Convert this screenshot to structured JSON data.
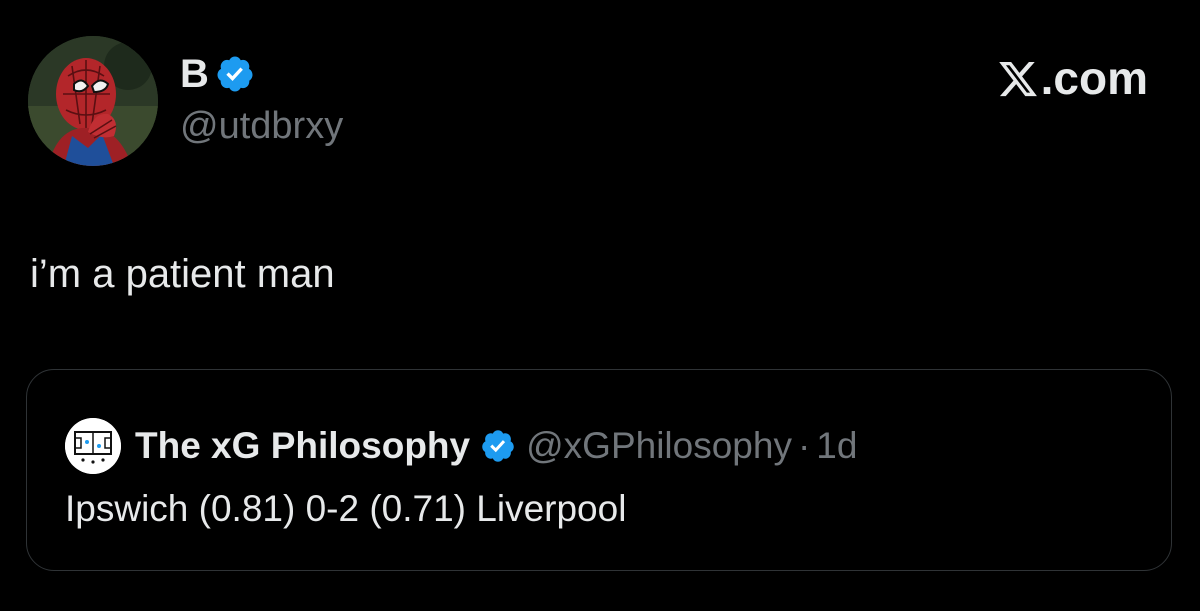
{
  "author": {
    "display_name": "B",
    "handle": "@utdbrxy",
    "verified": true,
    "avatar_icon": "spider-man-avatar"
  },
  "brand": {
    "label": ".com",
    "icon": "x-logo-icon"
  },
  "tweet": {
    "text": "i’m a patient man"
  },
  "quoted_tweet": {
    "display_name": "The xG Philosophy",
    "handle": "@xGPhilosophy",
    "separator": "·",
    "time": "1d",
    "verified": true,
    "text": "Ipswich (0.81) 0-2 (0.71) Liverpool",
    "avatar_icon": "tactics-board-avatar"
  },
  "colors": {
    "background": "#000000",
    "primary_text": "#e7e9ea",
    "secondary_text": "#71767b",
    "verified_blue": "#1d9bf0",
    "card_border": "#2f3336"
  }
}
